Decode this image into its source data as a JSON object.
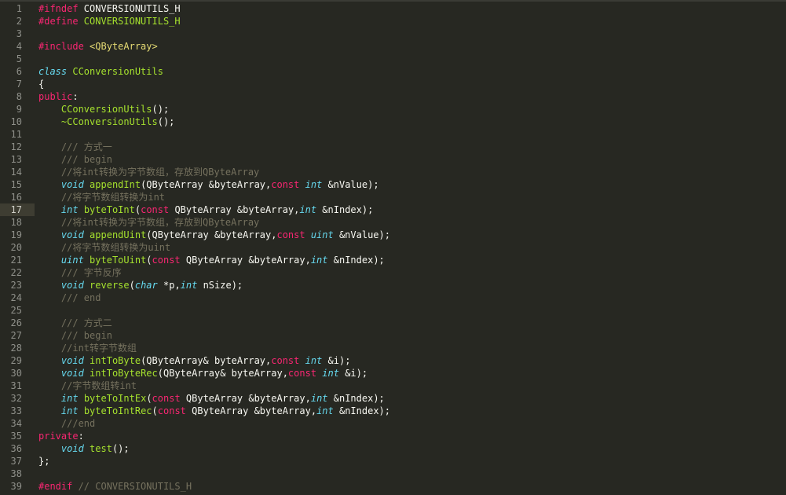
{
  "editor": {
    "active_line": 17,
    "colors": {
      "background": "#272822",
      "keyword": "#f92672",
      "type": "#66d9ef",
      "function": "#a6e22e",
      "string": "#e6db74",
      "comment": "#75715e",
      "text": "#f8f8f2",
      "line_number": "#8f908a"
    },
    "lines": [
      {
        "num": "1",
        "tokens": [
          {
            "t": "#ifndef",
            "k": "keyword"
          },
          {
            "t": " CONVERSIONUTILS_H",
            "k": "plain"
          }
        ]
      },
      {
        "num": "2",
        "tokens": [
          {
            "t": "#define",
            "k": "keyword"
          },
          {
            "t": " CONVERSIONUTILS_H",
            "k": "func"
          }
        ]
      },
      {
        "num": "3",
        "tokens": []
      },
      {
        "num": "4",
        "tokens": [
          {
            "t": "#include",
            "k": "keyword"
          },
          {
            "t": " <QByteArray>",
            "k": "string"
          }
        ]
      },
      {
        "num": "5",
        "tokens": []
      },
      {
        "num": "6",
        "tokens": [
          {
            "t": "class",
            "k": "type"
          },
          {
            "t": " ",
            "k": "plain"
          },
          {
            "t": "CConversionUtils",
            "k": "func"
          }
        ]
      },
      {
        "num": "7",
        "tokens": [
          {
            "t": "{",
            "k": "plain"
          }
        ]
      },
      {
        "num": "8",
        "tokens": [
          {
            "t": "public",
            "k": "keyword"
          },
          {
            "t": ":",
            "k": "plain"
          }
        ]
      },
      {
        "num": "9",
        "tokens": [
          {
            "t": "    ",
            "k": "plain"
          },
          {
            "t": "CConversionUtils",
            "k": "func"
          },
          {
            "t": "();",
            "k": "plain"
          }
        ]
      },
      {
        "num": "10",
        "tokens": [
          {
            "t": "    ",
            "k": "plain"
          },
          {
            "t": "~CConversionUtils",
            "k": "func"
          },
          {
            "t": "();",
            "k": "plain"
          }
        ]
      },
      {
        "num": "11",
        "tokens": []
      },
      {
        "num": "12",
        "tokens": [
          {
            "t": "    /// 方式一",
            "k": "comment"
          }
        ]
      },
      {
        "num": "13",
        "tokens": [
          {
            "t": "    /// begin",
            "k": "comment"
          }
        ]
      },
      {
        "num": "14",
        "tokens": [
          {
            "t": "    //将int转换为字节数组，存放到QByteArray",
            "k": "comment"
          }
        ]
      },
      {
        "num": "15",
        "tokens": [
          {
            "t": "    ",
            "k": "plain"
          },
          {
            "t": "void",
            "k": "type"
          },
          {
            "t": " ",
            "k": "plain"
          },
          {
            "t": "appendInt",
            "k": "func"
          },
          {
            "t": "(QByteArray &byteArray,",
            "k": "plain"
          },
          {
            "t": "const",
            "k": "keyword"
          },
          {
            "t": " ",
            "k": "plain"
          },
          {
            "t": "int",
            "k": "type"
          },
          {
            "t": " &nValue);",
            "k": "plain"
          }
        ]
      },
      {
        "num": "16",
        "tokens": [
          {
            "t": "    //将字节数组转换为int",
            "k": "comment"
          }
        ]
      },
      {
        "num": "17",
        "tokens": [
          {
            "t": "    ",
            "k": "plain"
          },
          {
            "t": "int",
            "k": "type"
          },
          {
            "t": " ",
            "k": "plain"
          },
          {
            "t": "byteToInt",
            "k": "func"
          },
          {
            "t": "(",
            "k": "plain"
          },
          {
            "t": "const",
            "k": "keyword"
          },
          {
            "t": " QByteArray &byteArray,",
            "k": "plain"
          },
          {
            "t": "int",
            "k": "type"
          },
          {
            "t": " &nIndex);",
            "k": "plain"
          }
        ]
      },
      {
        "num": "18",
        "tokens": [
          {
            "t": "    //将int转换为字节数组，存放到QByteArray",
            "k": "comment"
          }
        ]
      },
      {
        "num": "19",
        "tokens": [
          {
            "t": "    ",
            "k": "plain"
          },
          {
            "t": "void",
            "k": "type"
          },
          {
            "t": " ",
            "k": "plain"
          },
          {
            "t": "appendUint",
            "k": "func"
          },
          {
            "t": "(QByteArray &byteArray,",
            "k": "plain"
          },
          {
            "t": "const",
            "k": "keyword"
          },
          {
            "t": " ",
            "k": "plain"
          },
          {
            "t": "uint",
            "k": "type"
          },
          {
            "t": " &nValue);",
            "k": "plain"
          }
        ]
      },
      {
        "num": "20",
        "tokens": [
          {
            "t": "    //将字节数组转换为uint",
            "k": "comment"
          }
        ]
      },
      {
        "num": "21",
        "tokens": [
          {
            "t": "    ",
            "k": "plain"
          },
          {
            "t": "uint",
            "k": "type"
          },
          {
            "t": " ",
            "k": "plain"
          },
          {
            "t": "byteToUint",
            "k": "func"
          },
          {
            "t": "(",
            "k": "plain"
          },
          {
            "t": "const",
            "k": "keyword"
          },
          {
            "t": " QByteArray &byteArray,",
            "k": "plain"
          },
          {
            "t": "int",
            "k": "type"
          },
          {
            "t": " &nIndex);",
            "k": "plain"
          }
        ]
      },
      {
        "num": "22",
        "tokens": [
          {
            "t": "    /// 字节反序",
            "k": "comment"
          }
        ]
      },
      {
        "num": "23",
        "tokens": [
          {
            "t": "    ",
            "k": "plain"
          },
          {
            "t": "void",
            "k": "type"
          },
          {
            "t": " ",
            "k": "plain"
          },
          {
            "t": "reverse",
            "k": "func"
          },
          {
            "t": "(",
            "k": "plain"
          },
          {
            "t": "char",
            "k": "type"
          },
          {
            "t": " *p,",
            "k": "plain"
          },
          {
            "t": "int",
            "k": "type"
          },
          {
            "t": " nSize);",
            "k": "plain"
          }
        ]
      },
      {
        "num": "24",
        "tokens": [
          {
            "t": "    /// end",
            "k": "comment"
          }
        ]
      },
      {
        "num": "25",
        "tokens": []
      },
      {
        "num": "26",
        "tokens": [
          {
            "t": "    /// 方式二",
            "k": "comment"
          }
        ]
      },
      {
        "num": "27",
        "tokens": [
          {
            "t": "    /// begin",
            "k": "comment"
          }
        ]
      },
      {
        "num": "28",
        "tokens": [
          {
            "t": "    //int转字节数组",
            "k": "comment"
          }
        ]
      },
      {
        "num": "29",
        "tokens": [
          {
            "t": "    ",
            "k": "plain"
          },
          {
            "t": "void",
            "k": "type"
          },
          {
            "t": " ",
            "k": "plain"
          },
          {
            "t": "intToByte",
            "k": "func"
          },
          {
            "t": "(QByteArray& byteArray,",
            "k": "plain"
          },
          {
            "t": "const",
            "k": "keyword"
          },
          {
            "t": " ",
            "k": "plain"
          },
          {
            "t": "int",
            "k": "type"
          },
          {
            "t": " &i);",
            "k": "plain"
          }
        ]
      },
      {
        "num": "30",
        "tokens": [
          {
            "t": "    ",
            "k": "plain"
          },
          {
            "t": "void",
            "k": "type"
          },
          {
            "t": " ",
            "k": "plain"
          },
          {
            "t": "intToByteRec",
            "k": "func"
          },
          {
            "t": "(QByteArray& byteArray,",
            "k": "plain"
          },
          {
            "t": "const",
            "k": "keyword"
          },
          {
            "t": " ",
            "k": "plain"
          },
          {
            "t": "int",
            "k": "type"
          },
          {
            "t": " &i);",
            "k": "plain"
          }
        ]
      },
      {
        "num": "31",
        "tokens": [
          {
            "t": "    //字节数组转int",
            "k": "comment"
          }
        ]
      },
      {
        "num": "32",
        "tokens": [
          {
            "t": "    ",
            "k": "plain"
          },
          {
            "t": "int",
            "k": "type"
          },
          {
            "t": " ",
            "k": "plain"
          },
          {
            "t": "byteToIntEx",
            "k": "func"
          },
          {
            "t": "(",
            "k": "plain"
          },
          {
            "t": "const",
            "k": "keyword"
          },
          {
            "t": " QByteArray &byteArray,",
            "k": "plain"
          },
          {
            "t": "int",
            "k": "type"
          },
          {
            "t": " &nIndex);",
            "k": "plain"
          }
        ]
      },
      {
        "num": "33",
        "tokens": [
          {
            "t": "    ",
            "k": "plain"
          },
          {
            "t": "int",
            "k": "type"
          },
          {
            "t": " ",
            "k": "plain"
          },
          {
            "t": "byteToIntRec",
            "k": "func"
          },
          {
            "t": "(",
            "k": "plain"
          },
          {
            "t": "const",
            "k": "keyword"
          },
          {
            "t": " QByteArray &byteArray,",
            "k": "plain"
          },
          {
            "t": "int",
            "k": "type"
          },
          {
            "t": " &nIndex);",
            "k": "plain"
          }
        ]
      },
      {
        "num": "34",
        "tokens": [
          {
            "t": "    ///end",
            "k": "comment"
          }
        ]
      },
      {
        "num": "35",
        "tokens": [
          {
            "t": "private",
            "k": "keyword"
          },
          {
            "t": ":",
            "k": "plain"
          }
        ]
      },
      {
        "num": "36",
        "tokens": [
          {
            "t": "    ",
            "k": "plain"
          },
          {
            "t": "void",
            "k": "type"
          },
          {
            "t": " ",
            "k": "plain"
          },
          {
            "t": "test",
            "k": "func"
          },
          {
            "t": "();",
            "k": "plain"
          }
        ]
      },
      {
        "num": "37",
        "tokens": [
          {
            "t": "};",
            "k": "plain"
          }
        ]
      },
      {
        "num": "38",
        "tokens": []
      },
      {
        "num": "39",
        "tokens": [
          {
            "t": "#endif",
            "k": "keyword"
          },
          {
            "t": " // CONVERSIONUTILS_H",
            "k": "comment"
          }
        ]
      }
    ]
  }
}
